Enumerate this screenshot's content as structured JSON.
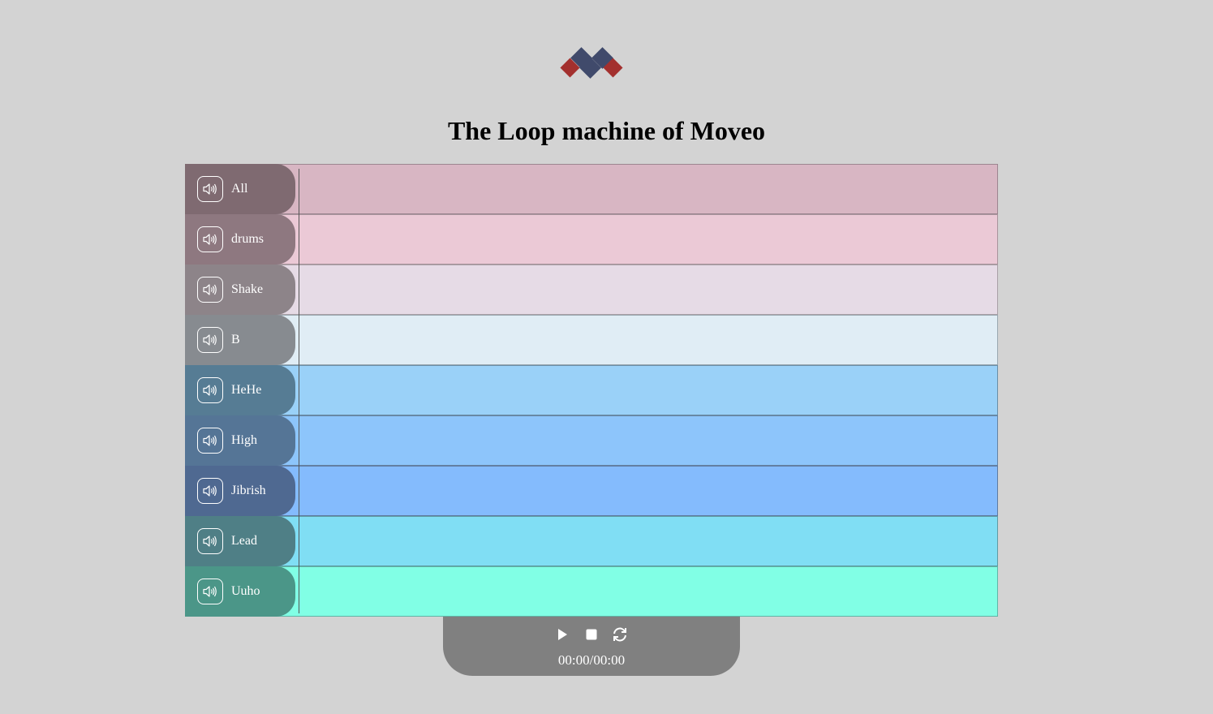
{
  "header": {
    "logo": "moveo-diamond-logo",
    "title": "The Loop machine of Moveo"
  },
  "tracks": [
    {
      "label": "All",
      "icon": "speaker-icon",
      "head_color": "#7f6a71",
      "lane_color": "#d8b6c3",
      "border_color": "#9c8690"
    },
    {
      "label": "drums",
      "icon": "speaker-icon",
      "head_color": "#8e7880",
      "lane_color": "#ebc9d6",
      "border_color": "#a8949c"
    },
    {
      "label": "Shake",
      "icon": "speaker-icon",
      "head_color": "#8d8489",
      "lane_color": "#e6dbe6",
      "border_color": "#a9a0a6"
    },
    {
      "label": "B",
      "icon": "speaker-icon",
      "head_color": "#878b90",
      "lane_color": "#e0edf5",
      "border_color": "#9aa7b0"
    },
    {
      "label": "HeHe",
      "icon": "speaker-icon",
      "head_color": "#567c94",
      "lane_color": "#9ad1f8",
      "border_color": "#6a8ea6"
    },
    {
      "label": "High",
      "icon": "speaker-icon",
      "head_color": "#557596",
      "lane_color": "#8dc5fb",
      "border_color": "#6583a3"
    },
    {
      "label": "Jibrish",
      "icon": "speaker-icon",
      "head_color": "#4f6991",
      "lane_color": "#84bbfd",
      "border_color": "#5f7aa0"
    },
    {
      "label": "Lead",
      "icon": "speaker-icon",
      "head_color": "#4f7f86",
      "lane_color": "#80def4",
      "border_color": "#5f9aa3"
    },
    {
      "label": "Uuho",
      "icon": "speaker-icon",
      "head_color": "#4b9688",
      "lane_color": "#81ffe5",
      "border_color": "#5fb5a6"
    }
  ],
  "controls": {
    "play_icon": "play-icon",
    "stop_icon": "stop-icon",
    "loop_icon": "loop-icon",
    "time": "00:00/00:00"
  },
  "colors": {
    "background": "#d3d3d3",
    "control_bar": "#808080",
    "logo_navy": "#404a6b",
    "logo_red": "#a3302e"
  }
}
